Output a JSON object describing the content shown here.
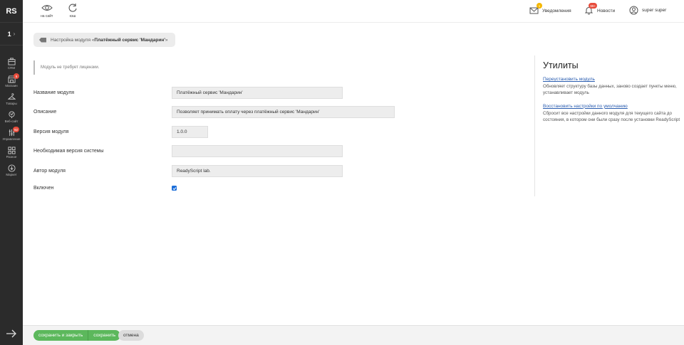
{
  "sidebar": {
    "logo": "RS",
    "site_number": "1",
    "items": [
      {
        "label": "CRM",
        "icon": "crm-icon",
        "badge": ""
      },
      {
        "label": "Магазин",
        "icon": "shop-icon",
        "badge": "5"
      },
      {
        "label": "Товары",
        "icon": "hanger-icon",
        "badge": ""
      },
      {
        "label": "Веб-сайт",
        "icon": "website-icon",
        "badge": ""
      },
      {
        "label": "Управление",
        "icon": "sliders-icon",
        "badge": "92"
      },
      {
        "label": "Разное",
        "icon": "grid-icon",
        "badge": ""
      },
      {
        "label": "Маркет",
        "icon": "download-icon",
        "badge": ""
      }
    ]
  },
  "topbar": {
    "to_site_label": "на сайт",
    "cache_label": "кэш",
    "notifications_label": "Уведомления",
    "notifications_badge": "1",
    "news_label": "Новости",
    "news_badge": "99+",
    "user_name": "super super"
  },
  "breadcrumb": {
    "prefix": "Настройка модуля «",
    "module": "Платёжный сервис 'Мандарин'",
    "suffix": "»"
  },
  "license_note": "Модуль не требует лицензии.",
  "form": {
    "name_label": "Название модуля",
    "name_value": "Платёжный сервис 'Мандарин'",
    "description_label": "Описание",
    "description_value": "Позволяет принимать оплату через платёжный сервис 'Мандарин'",
    "version_label": "Версия модуля",
    "version_value": "1.0.0",
    "system_version_label": "Необходимая версия системы",
    "system_version_value": "",
    "author_label": "Автор модуля",
    "author_value": "ReadyScript lab.",
    "enabled_label": "Включен",
    "enabled": true
  },
  "utilities": {
    "title": "Утилиты",
    "reinstall_link": "Переустановить модуль",
    "reinstall_desc": "Обновляет структуру базы данных, заново создает пункты меню, устанавливает модуль",
    "restore_link": "Восстановить настройки по умолчанию",
    "restore_desc": "Сбросит все настройки данного модуля для текущего сайта до состояния, в котором они были сразу после установки ReadyScript"
  },
  "bottombar": {
    "save_close_label": "сохранить и закрыть",
    "save_label": "сохранить",
    "cancel_label": "отмена"
  },
  "colors": {
    "sidebar_bg": "#2b2b2b",
    "accent_green": "#5cb85c",
    "link_blue": "#2a5db0",
    "badge_red": "#e74c3c",
    "badge_yellow": "#f5b700",
    "checkbox_blue": "#1e6fd9"
  }
}
